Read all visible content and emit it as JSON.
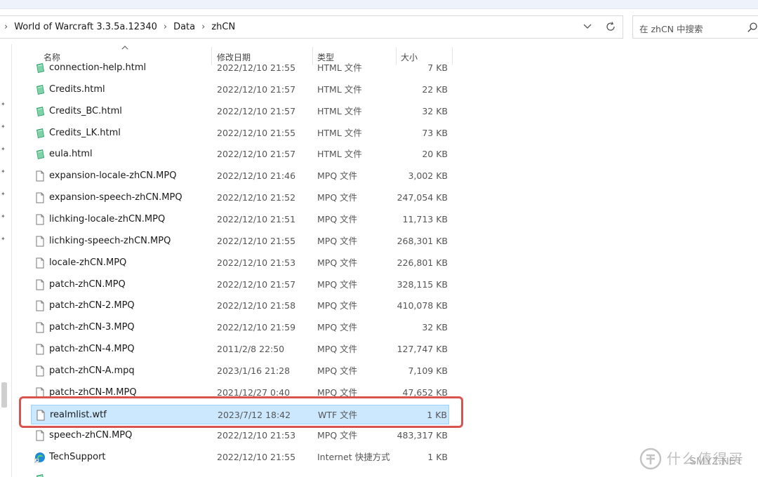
{
  "address": {
    "crumbs": [
      "World of Warcraft 3.3.5a.12340",
      "Data",
      "zhCN"
    ]
  },
  "search": {
    "placeholder": "在 zhCN 中搜索"
  },
  "columns": {
    "name": "名称",
    "date": "修改日期",
    "type": "类型",
    "size": "大小"
  },
  "files": [
    {
      "name": "connection-help.html",
      "date": "2022/12/10 21:55",
      "type": "HTML 文件",
      "size": "7 KB",
      "icon": "html-file-icon"
    },
    {
      "name": "Credits.html",
      "date": "2022/12/10 21:57",
      "type": "HTML 文件",
      "size": "22 KB",
      "icon": "html-file-icon"
    },
    {
      "name": "Credits_BC.html",
      "date": "2022/12/10 21:57",
      "type": "HTML 文件",
      "size": "32 KB",
      "icon": "html-file-icon"
    },
    {
      "name": "Credits_LK.html",
      "date": "2022/12/10 21:55",
      "type": "HTML 文件",
      "size": "73 KB",
      "icon": "html-file-icon"
    },
    {
      "name": "eula.html",
      "date": "2022/12/10 21:57",
      "type": "HTML 文件",
      "size": "20 KB",
      "icon": "html-file-icon"
    },
    {
      "name": "expansion-locale-zhCN.MPQ",
      "date": "2022/12/10 21:46",
      "type": "MPQ 文件",
      "size": "3,002 KB",
      "icon": "blank-file-icon"
    },
    {
      "name": "expansion-speech-zhCN.MPQ",
      "date": "2022/12/10 21:52",
      "type": "MPQ 文件",
      "size": "247,054 KB",
      "icon": "blank-file-icon"
    },
    {
      "name": "lichking-locale-zhCN.MPQ",
      "date": "2022/12/10 21:51",
      "type": "MPQ 文件",
      "size": "11,713 KB",
      "icon": "blank-file-icon"
    },
    {
      "name": "lichking-speech-zhCN.MPQ",
      "date": "2022/12/10 21:55",
      "type": "MPQ 文件",
      "size": "268,301 KB",
      "icon": "blank-file-icon"
    },
    {
      "name": "locale-zhCN.MPQ",
      "date": "2022/12/10 21:53",
      "type": "MPQ 文件",
      "size": "226,801 KB",
      "icon": "blank-file-icon"
    },
    {
      "name": "patch-zhCN.MPQ",
      "date": "2022/12/10 21:57",
      "type": "MPQ 文件",
      "size": "328,115 KB",
      "icon": "blank-file-icon"
    },
    {
      "name": "patch-zhCN-2.MPQ",
      "date": "2022/12/10 21:58",
      "type": "MPQ 文件",
      "size": "410,078 KB",
      "icon": "blank-file-icon"
    },
    {
      "name": "patch-zhCN-3.MPQ",
      "date": "2022/12/10 21:59",
      "type": "MPQ 文件",
      "size": "32 KB",
      "icon": "blank-file-icon"
    },
    {
      "name": "patch-zhCN-4.MPQ",
      "date": "2011/2/8 22:50",
      "type": "MPQ 文件",
      "size": "127,747 KB",
      "icon": "blank-file-icon"
    },
    {
      "name": "patch-zhCN-A.mpq",
      "date": "2023/1/16 21:28",
      "type": "MPQ 文件",
      "size": "7,109 KB",
      "icon": "blank-file-icon"
    },
    {
      "name": "patch-zhCN-M.MPQ",
      "date": "2021/12/27 0:40",
      "type": "MPQ 文件",
      "size": "47,652 KB",
      "icon": "blank-file-icon"
    },
    {
      "name": "realmlist.wtf",
      "date": "2023/7/12 18:42",
      "type": "WTF 文件",
      "size": "1 KB",
      "icon": "blank-file-icon",
      "selected": true
    },
    {
      "name": "speech-zhCN.MPQ",
      "date": "2022/12/10 21:53",
      "type": "MPQ 文件",
      "size": "483,317 KB",
      "icon": "blank-file-icon"
    },
    {
      "name": "TechSupport",
      "date": "2022/12/10 21:55",
      "type": "Internet 快捷方式",
      "size": "1 KB",
      "icon": "edge-shortcut-icon"
    },
    {
      "name": "",
      "date": "",
      "type": "",
      "size": "",
      "icon": "html-file-icon"
    }
  ],
  "watermark": {
    "text_cn": "什么值得买",
    "text_en": "SMYZ.NET"
  },
  "colors": {
    "selection_bg": "#cce8ff",
    "selection_border": "#99d1ff",
    "highlight": "#d9534f"
  }
}
